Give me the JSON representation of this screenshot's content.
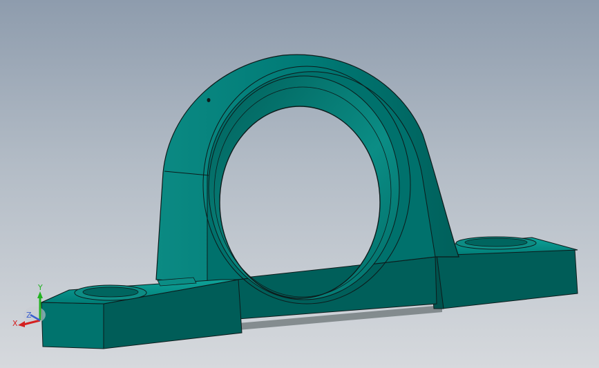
{
  "viewport": {
    "model": "pillow-block-bearing-housing",
    "colors": {
      "background_top": "#8e9cad",
      "background_bottom": "#d6d9dd",
      "body": "#007a76",
      "body_light": "#0a9a92",
      "body_dark": "#005852",
      "edge": "#0d1a1a"
    }
  },
  "triad": {
    "x_label": "X",
    "y_label": "Y",
    "z_label": "Z",
    "x_color": "#d42020",
    "y_color": "#22b222",
    "z_color": "#3a5fcf"
  }
}
